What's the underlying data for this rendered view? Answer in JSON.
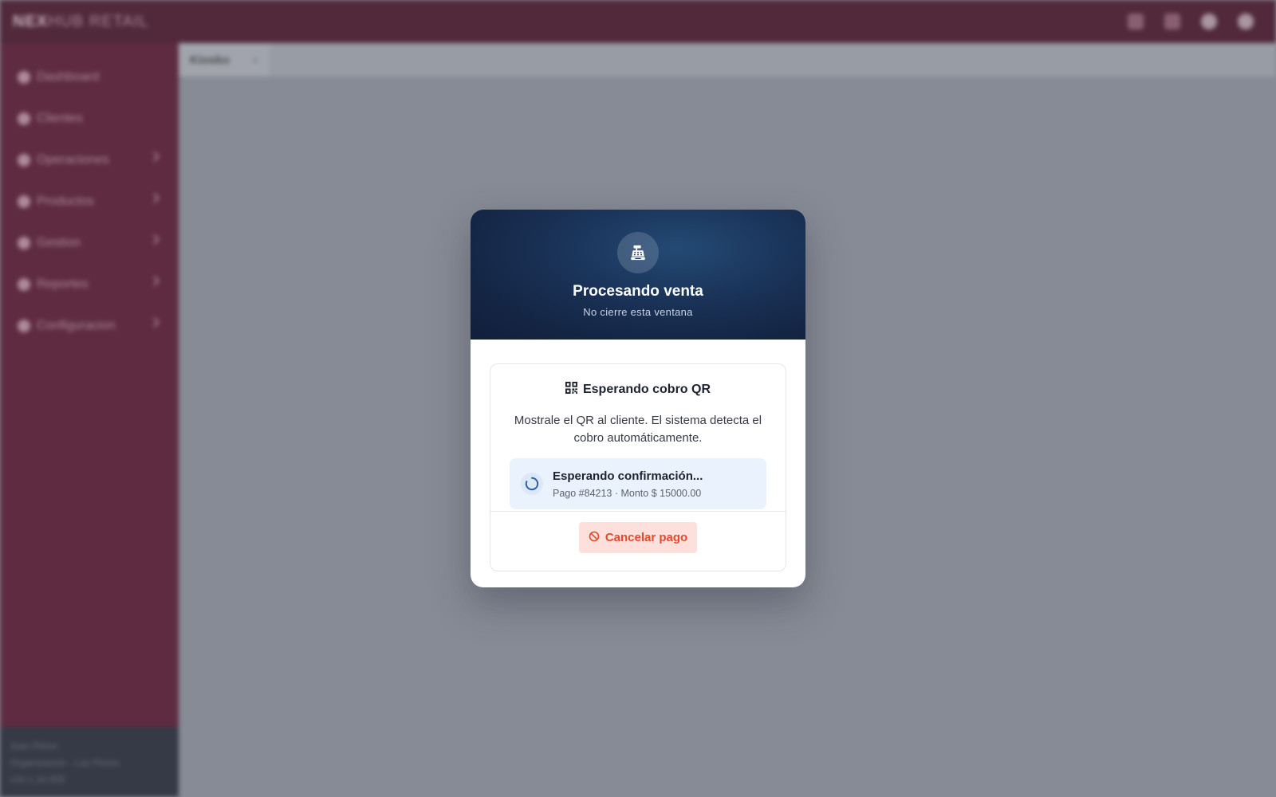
{
  "app": {
    "brand_bold": "NEX",
    "brand_rest": "HUB RETAIL",
    "top_icons": [
      "list-icon",
      "store-icon",
      "search-icon",
      "user-icon"
    ]
  },
  "sidebar": {
    "items": [
      {
        "label": "Dashboard",
        "icon": "dashboard-icon",
        "has_submenu": false
      },
      {
        "label": "Clientes",
        "icon": "clients-icon",
        "has_submenu": false
      },
      {
        "label": "Operaciones",
        "icon": "operations-icon",
        "has_submenu": true
      },
      {
        "label": "Productos",
        "icon": "products-icon",
        "has_submenu": true
      },
      {
        "label": "Gestion",
        "icon": "management-icon",
        "has_submenu": true
      },
      {
        "label": "Reportes",
        "icon": "reports-icon",
        "has_submenu": true
      },
      {
        "label": "Configuracion",
        "icon": "settings-icon",
        "has_submenu": true
      }
    ],
    "footer": {
      "user": "Juan Pérez",
      "org": "Organizacion - Las Flores",
      "version": "v10.1.10.000"
    }
  },
  "tabs": [
    {
      "label": "Kiosko",
      "close": "×"
    }
  ],
  "modal": {
    "header": {
      "icon": "cash-register-icon",
      "title": "Procesando venta",
      "subtitle": "No cierre esta ventana"
    },
    "card": {
      "title_icon": "qr-code-icon",
      "title": "Esperando cobro QR",
      "description": "Mostrale el QR al cliente. El sistema detecta el cobro automáticamente.",
      "status": {
        "icon": "spinner-icon",
        "title": "Esperando confirmación...",
        "detail": "Pago #84213 · Monto $ 15000.00"
      },
      "cancel_button": {
        "icon": "ban-icon",
        "label": "Cancelar pago"
      }
    }
  },
  "colors": {
    "topbar": "#4a1b2c",
    "sidebar": "#5a1d33",
    "modal_header": "#1a3358",
    "cancel_text": "#e04a2f",
    "cancel_bg": "#fde0dc",
    "status_bg": "#eaf2fd"
  }
}
